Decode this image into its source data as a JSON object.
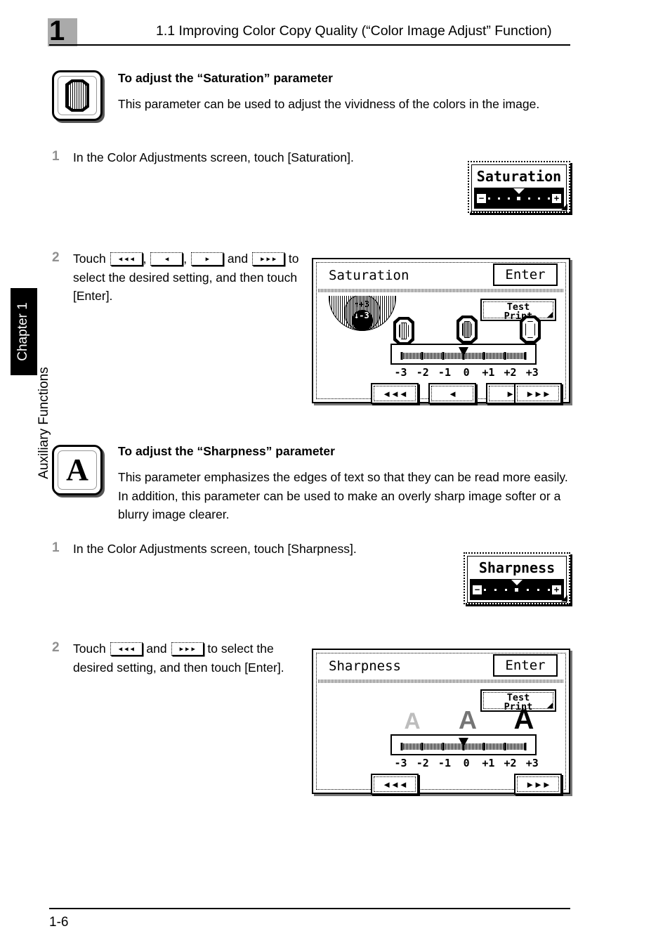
{
  "header": {
    "chapter_number": "1",
    "title": "1.1 Improving Color Copy Quality (“Color Image Adjust” Function)"
  },
  "side_tab": {
    "chapter_label": "Chapter 1",
    "section_label": "Auxiliary Functions"
  },
  "footer": {
    "page": "1-6"
  },
  "sections": [
    {
      "icon_name": "gem-icon",
      "heading": "To adjust the “Saturation” parameter",
      "body": "This parameter can be used to adjust the vividness of the colors in the image.",
      "steps": [
        {
          "number": "1",
          "text": "In the Color Adjustments screen, touch [Saturation]."
        },
        {
          "number": "2",
          "text_parts": [
            "Touch ",
            ", ",
            ", ",
            " and ",
            " to select the desired setting, and then touch [Enter]."
          ],
          "buttons": [
            "◄◄◄",
            "◄",
            "►",
            "►►►"
          ]
        }
      ],
      "lcd_key": {
        "label": "Saturation",
        "minus": "−",
        "plus": "+"
      },
      "panel": {
        "title": "Saturation",
        "enter_label": "Enter",
        "test_print_line1": "Test",
        "test_print_line2": "Print",
        "gauge": {
          "high": "+3",
          "low": "-3"
        },
        "scale_labels": [
          "-3",
          "-2",
          "-1",
          "0",
          "+1",
          "+2",
          "+3"
        ],
        "current_value": "0",
        "arrow_buttons": [
          "◄◄◄",
          "◄",
          "►",
          "►►►"
        ],
        "samples": [
          "gem-low",
          "gem-mid",
          "gem-high"
        ]
      }
    },
    {
      "icon_name": "letter-a-icon",
      "heading": "To adjust the “Sharpness” parameter",
      "body": "This parameter emphasizes the edges of text so that they can be read more easily. In addition, this parameter can be used to make an overly sharp image softer or a blurry image clearer.",
      "steps": [
        {
          "number": "1",
          "text": "In the Color Adjustments screen, touch [Sharpness]."
        },
        {
          "number": "2",
          "text_parts": [
            "Touch ",
            " and ",
            " to select the desired setting, and then touch [Enter]."
          ],
          "buttons": [
            "◄◄◄",
            "►►►"
          ]
        }
      ],
      "lcd_key": {
        "label": "Sharpness",
        "minus": "−",
        "plus": "+"
      },
      "panel": {
        "title": "Sharpness",
        "enter_label": "Enter",
        "test_print_line1": "Test",
        "test_print_line2": "Print",
        "scale_labels": [
          "-3",
          "-2",
          "-1",
          "0",
          "+1",
          "+2",
          "+3"
        ],
        "current_value": "0",
        "arrow_buttons": [
          "◄◄◄",
          "►►►"
        ],
        "samples": [
          "A",
          "A",
          "A"
        ]
      }
    }
  ],
  "colors": {
    "chapter_box": "#aaaaaa",
    "step_number": "#909090",
    "rule": "#000000"
  }
}
